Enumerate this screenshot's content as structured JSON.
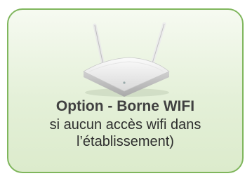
{
  "card": {
    "title": "Option - Borne WIFI",
    "line1": "si aucun accès wifi dans",
    "line2": "l’établissement)"
  },
  "image": {
    "icon": "wifi-router-image"
  },
  "colors": {
    "border": "#7fb65c",
    "background": "#e4f0d8",
    "text": "#404040"
  }
}
